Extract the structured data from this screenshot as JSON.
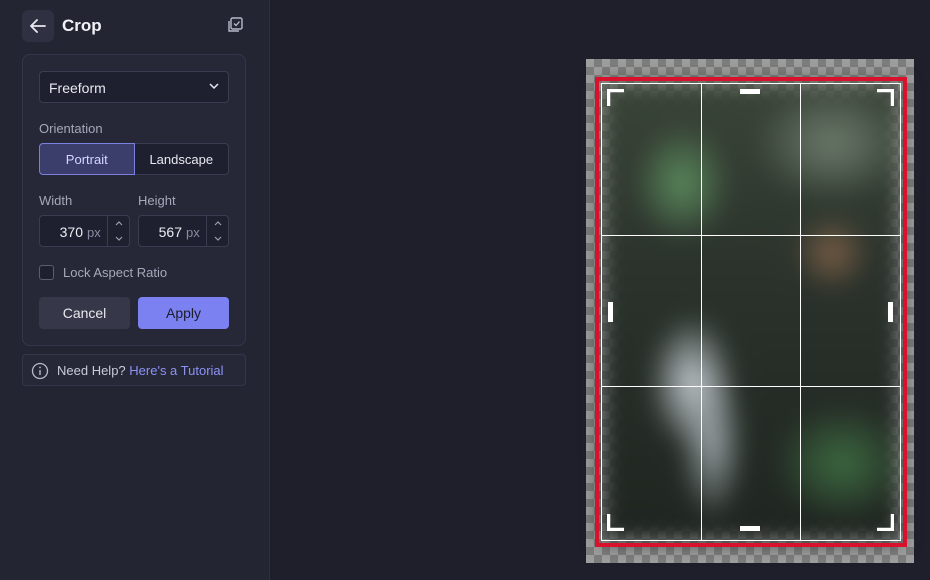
{
  "header": {
    "title": "Crop"
  },
  "crop_panel": {
    "aspect_select": {
      "value": "Freeform"
    },
    "orientation": {
      "label": "Orientation",
      "options": [
        "Portrait",
        "Landscape"
      ],
      "selected": "Portrait"
    },
    "width": {
      "label": "Width",
      "value": "370",
      "unit": "px"
    },
    "height": {
      "label": "Height",
      "value": "567",
      "unit": "px"
    },
    "lock_aspect": {
      "label": "Lock Aspect Ratio",
      "checked": false
    },
    "cancel_label": "Cancel",
    "apply_label": "Apply"
  },
  "help": {
    "text": "Need Help?",
    "link": "Here's a Tutorial"
  },
  "colors": {
    "accent": "#7b81f0",
    "crop_border": "#d8122d",
    "background": "#1e1f2b"
  },
  "icons": [
    "back-arrow-icon",
    "copy-icon",
    "chevron-down-icon",
    "chevron-up-icon",
    "info-icon"
  ]
}
